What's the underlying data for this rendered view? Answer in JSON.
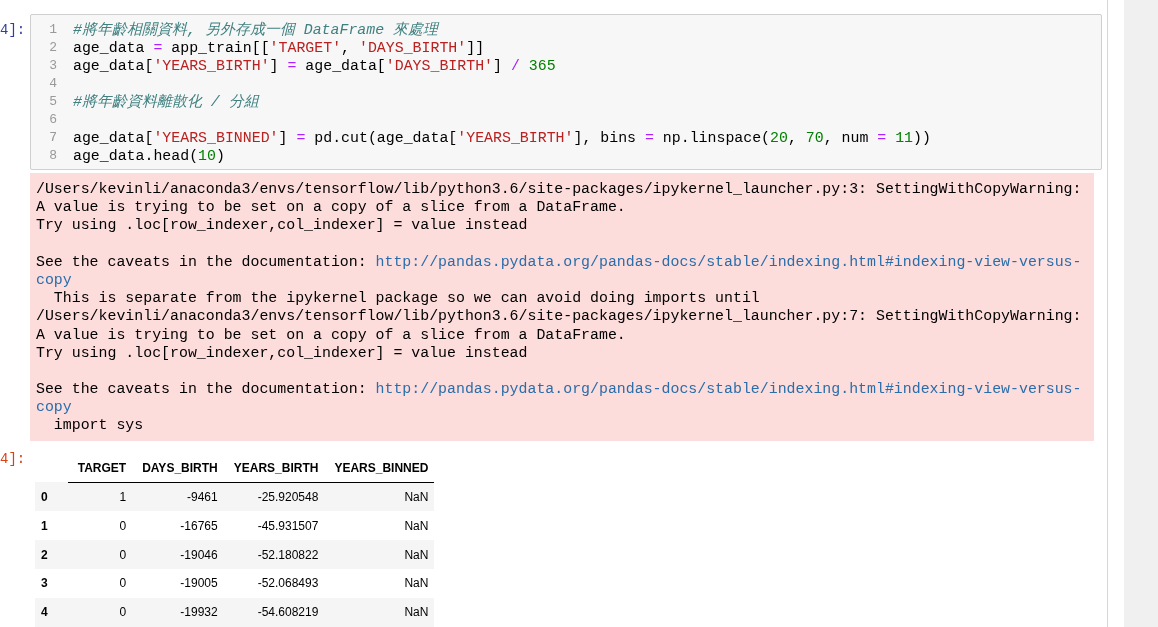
{
  "input_cell": {
    "prompt": "4]:",
    "lines": [
      {
        "number": "1",
        "tokens": [
          {
            "kind": "comment",
            "text": "#將年齡相關資料, 另外存成一個 DataFrame 來處理"
          }
        ]
      },
      {
        "number": "2",
        "tokens": [
          {
            "kind": "name",
            "text": "age_data "
          },
          {
            "kind": "op",
            "text": "="
          },
          {
            "kind": "name",
            "text": " app_train[["
          },
          {
            "kind": "string",
            "text": "'TARGET'"
          },
          {
            "kind": "name",
            "text": ", "
          },
          {
            "kind": "string",
            "text": "'DAYS_BIRTH'"
          },
          {
            "kind": "name",
            "text": "]]"
          }
        ]
      },
      {
        "number": "3",
        "tokens": [
          {
            "kind": "name",
            "text": "age_data["
          },
          {
            "kind": "string",
            "text": "'YEARS_BIRTH'"
          },
          {
            "kind": "name",
            "text": "] "
          },
          {
            "kind": "op",
            "text": "="
          },
          {
            "kind": "name",
            "text": " age_data["
          },
          {
            "kind": "string",
            "text": "'DAYS_BIRTH'"
          },
          {
            "kind": "name",
            "text": "] "
          },
          {
            "kind": "op",
            "text": "/"
          },
          {
            "kind": "number",
            "text": " 365"
          }
        ]
      },
      {
        "number": "4"
      },
      {
        "number": "5",
        "tokens": [
          {
            "kind": "comment",
            "text": "#將年齡資料離散化 / 分組"
          }
        ]
      },
      {
        "number": "6"
      },
      {
        "number": "7",
        "tokens": [
          {
            "kind": "name",
            "text": "age_data["
          },
          {
            "kind": "string",
            "text": "'YEARS_BINNED'"
          },
          {
            "kind": "name",
            "text": "] "
          },
          {
            "kind": "op",
            "text": "="
          },
          {
            "kind": "name",
            "text": " pd.cut(age_data["
          },
          {
            "kind": "string",
            "text": "'YEARS_BIRTH'"
          },
          {
            "kind": "name",
            "text": "], bins "
          },
          {
            "kind": "op",
            "text": "="
          },
          {
            "kind": "name",
            "text": " np.linspace("
          },
          {
            "kind": "number",
            "text": "20"
          },
          {
            "kind": "name",
            "text": ", "
          },
          {
            "kind": "number",
            "text": "70"
          },
          {
            "kind": "name",
            "text": ", num "
          },
          {
            "kind": "op",
            "text": "="
          },
          {
            "kind": "number",
            "text": " 11"
          },
          {
            "kind": "name",
            "text": "))"
          }
        ]
      },
      {
        "number": "8",
        "tokens": [
          {
            "kind": "name",
            "text": "age_data.head("
          },
          {
            "kind": "number",
            "text": "10"
          },
          {
            "kind": "name",
            "text": ")"
          }
        ]
      }
    ]
  },
  "stderr": {
    "lines": [
      {
        "kind": "text",
        "text": "/Users/kevinli/anaconda3/envs/tensorflow/lib/python3.6/site-packages/ipykernel_launcher.py:3: SettingWithCopyWarning:"
      },
      {
        "kind": "text",
        "text": "A value is trying to be set on a copy of a slice from a DataFrame."
      },
      {
        "kind": "text",
        "text": "Try using .loc[row_indexer,col_indexer] = value instead"
      },
      {
        "kind": "blank"
      },
      {
        "kind": "text",
        "text": "See the caveats in the documentation: ",
        "link": "http://pandas.pydata.org/pandas-docs/stable/indexing.html#indexing-view-versus-"
      },
      {
        "kind": "text",
        "link": "copy"
      },
      {
        "kind": "text",
        "text": "  This is separate from the ipykernel package so we can avoid doing imports until"
      },
      {
        "kind": "text",
        "text": "/Users/kevinli/anaconda3/envs/tensorflow/lib/python3.6/site-packages/ipykernel_launcher.py:7: SettingWithCopyWarning:"
      },
      {
        "kind": "text",
        "text": "A value is trying to be set on a copy of a slice from a DataFrame."
      },
      {
        "kind": "text",
        "text": "Try using .loc[row_indexer,col_indexer] = value instead"
      },
      {
        "kind": "blank"
      },
      {
        "kind": "text",
        "text": "See the caveats in the documentation: ",
        "link": "http://pandas.pydata.org/pandas-docs/stable/indexing.html#indexing-view-versus-"
      },
      {
        "kind": "text",
        "link": "copy"
      },
      {
        "kind": "text",
        "text": "  import sys"
      }
    ]
  },
  "output_cell": {
    "prompt": "4]:",
    "table": {
      "columns": [
        "TARGET",
        "DAYS_BIRTH",
        "YEARS_BIRTH",
        "YEARS_BINNED"
      ],
      "rows": [
        {
          "index": "0",
          "cells": [
            "1",
            "-9461",
            "-25.920548",
            "NaN"
          ]
        },
        {
          "index": "1",
          "cells": [
            "0",
            "-16765",
            "-45.931507",
            "NaN"
          ]
        },
        {
          "index": "2",
          "cells": [
            "0",
            "-19046",
            "-52.180822",
            "NaN"
          ]
        },
        {
          "index": "3",
          "cells": [
            "0",
            "-19005",
            "-52.068493",
            "NaN"
          ]
        },
        {
          "index": "4",
          "cells": [
            "0",
            "-19932",
            "-54.608219",
            "NaN"
          ]
        }
      ]
    }
  }
}
